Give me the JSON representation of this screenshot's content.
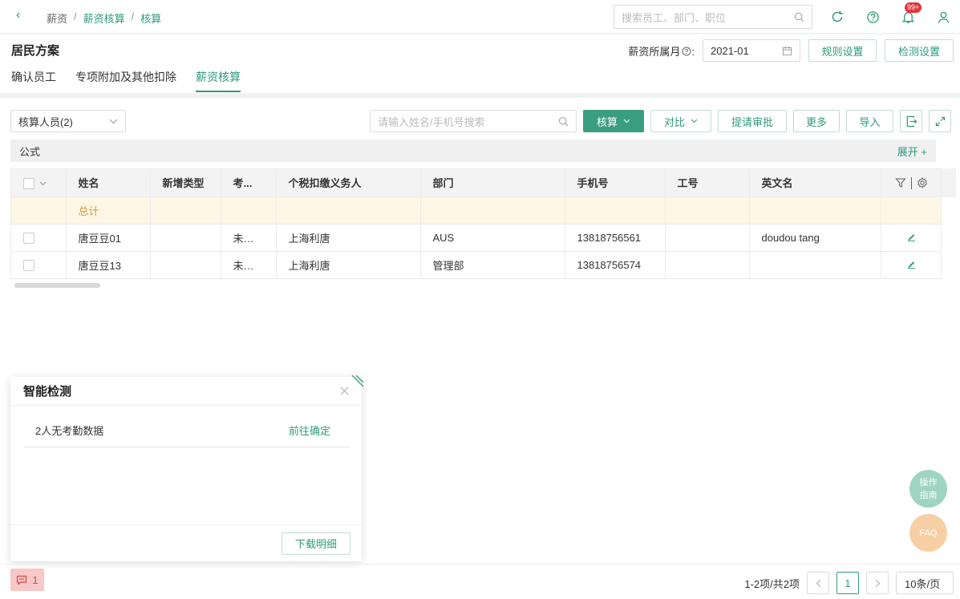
{
  "topbar": {
    "breadcrumbs": [
      "薪资",
      "薪资核算",
      "核算"
    ],
    "search_placeholder": "搜索员工、部门、职位",
    "notification_badge": "99+"
  },
  "header": {
    "title": "居民方案",
    "tabs": [
      {
        "label": "确认员工",
        "active": false
      },
      {
        "label": "专项附加及其他扣除",
        "active": false
      },
      {
        "label": "薪资核算",
        "active": true
      }
    ],
    "month_label": "薪资所属月",
    "month_value": "2021-01",
    "rule_button": "规则设置",
    "check_button": "检测设置"
  },
  "toolbar": {
    "people_select": "核算人员(2)",
    "search_placeholder": "请输入姓名/手机号搜索",
    "calc_button": "核算",
    "compare_button": "对比",
    "approval_button": "提请审批",
    "more_button": "更多",
    "import_button": "导入"
  },
  "formula": {
    "label": "公式",
    "expand": "展开 +"
  },
  "table": {
    "columns": [
      "姓名",
      "新增类型",
      "考...",
      "个税扣缴义务人",
      "部门",
      "手机号",
      "工号",
      "英文名"
    ],
    "total_label": "总计",
    "rows": [
      {
        "name": "唐豆豆01",
        "new_type": "",
        "attendance": "未确定",
        "tax_agent": "上海利唐",
        "dept": "AUS",
        "phone": "13818756561",
        "emp_no": "",
        "en_name": "doudou tang"
      },
      {
        "name": "唐豆豆13",
        "new_type": "",
        "attendance": "未确定",
        "tax_agent": "上海利唐",
        "dept": "管理部",
        "phone": "13818756574",
        "emp_no": "",
        "en_name": ""
      }
    ]
  },
  "popup": {
    "title": "智能检测",
    "item_text": "2人无考勤数据",
    "item_action": "前往确定",
    "download_button": "下载明细"
  },
  "fab": {
    "guide": "操作\n指南",
    "faq": "FAQ"
  },
  "footer": {
    "message_count": "1",
    "range_text": "1-2项/共2项",
    "current_page": "1",
    "page_size": "10条/页"
  },
  "colors": {
    "accent": "#2f9a7d",
    "primary_button": "#3a9d80",
    "total_row": "#fdf6e4",
    "badge": "#e0363b",
    "fab_guide": "#9ed4c2",
    "fab_faq": "#f7cfa4"
  }
}
